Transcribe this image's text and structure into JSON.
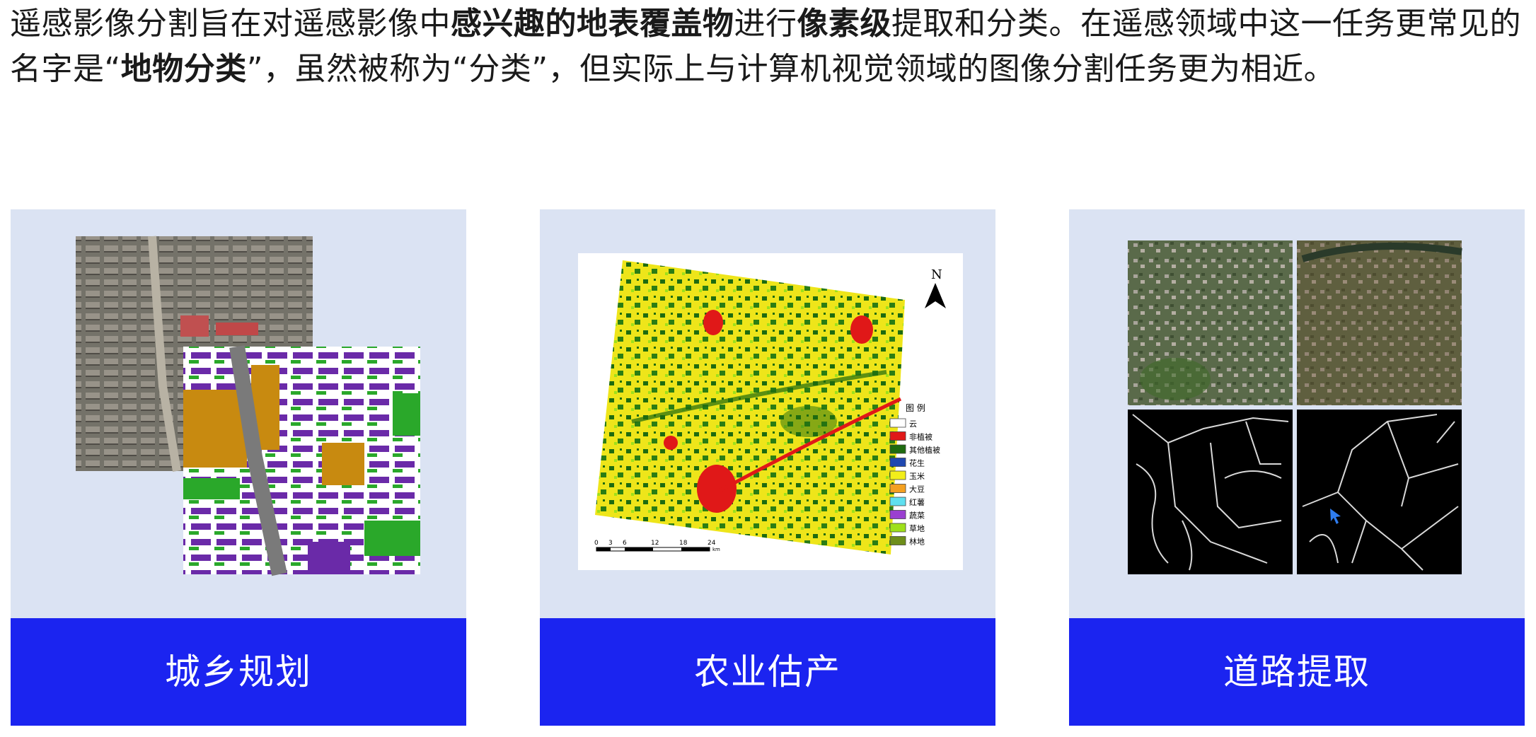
{
  "intro": {
    "p1": "遥感影像分割旨在对遥感影像中",
    "b1": "感兴趣的地表覆盖物",
    "p2": "进行",
    "b2": "像素级",
    "p3": "提取和分类。在遥感领域中这一任务更常见的名字是“",
    "b3": "地物分类",
    "p4": "”，虽然被称为“分类”，但实际上与计算机视觉领域的图像分割任务更为相近。"
  },
  "cards": [
    {
      "label": "城乡规划",
      "image": "urban-planning-segmentation"
    },
    {
      "label": "农业估产",
      "image": "crop-classification-map"
    },
    {
      "label": "道路提取",
      "image": "road-extraction"
    }
  ],
  "map": {
    "north": "N",
    "legend_title": "图 例",
    "legend": [
      {
        "name": "云",
        "color": "#ffffff"
      },
      {
        "name": "非植被",
        "color": "#e01818"
      },
      {
        "name": "其他植被",
        "color": "#1e6b10"
      },
      {
        "name": "花生",
        "color": "#1f48b0"
      },
      {
        "name": "玉米",
        "color": "#f2ee1a"
      },
      {
        "name": "大豆",
        "color": "#f4a020"
      },
      {
        "name": "红薯",
        "color": "#5fe0f0"
      },
      {
        "name": "蔬菜",
        "color": "#9a3fd0"
      },
      {
        "name": "草地",
        "color": "#9ee01a"
      },
      {
        "name": "林地",
        "color": "#6e8e1a"
      }
    ],
    "scale_ticks": [
      "0",
      "3",
      "6",
      "12",
      "18",
      "24"
    ],
    "scale_unit": "km"
  },
  "colors": {
    "card_bg": "#dbe3f3",
    "label_bg": "#1b24f0",
    "label_text": "#ffffff"
  }
}
